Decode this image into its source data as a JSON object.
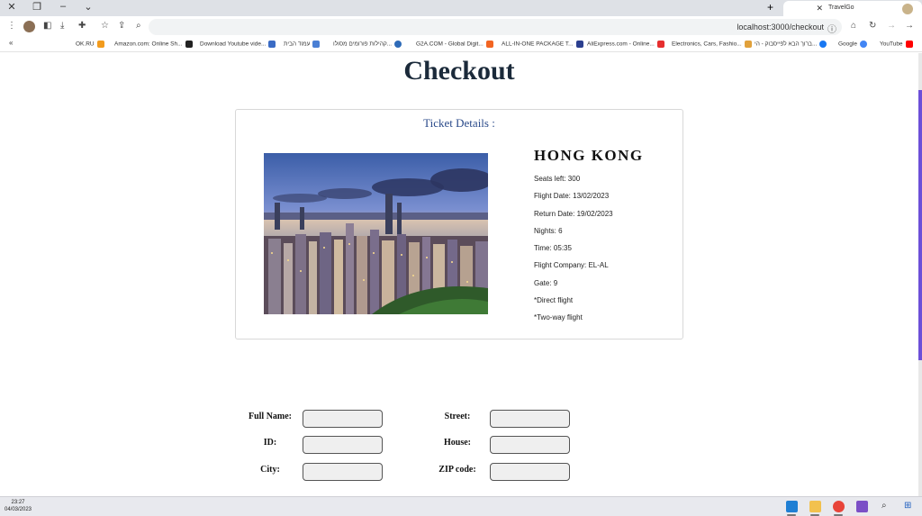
{
  "browser": {
    "tab_title": "TravelGo",
    "url": "localhost:3000/checkout",
    "bookmarks": [
      "OK.RU",
      "Amazon.com: Online Sh...",
      "Download Youtube vide...",
      "עמוד הבית",
      "קהילות פורומים מסולו...",
      "G2A.COM - Global Digit...",
      "ALL-IN-ONE PACKAGE T...",
      "AliExpress.com - Online...",
      "Electronics, Cars, Fashio...",
      "ברוך הבא לפייסבוק - הי...",
      "Google",
      "YouTube"
    ]
  },
  "page": {
    "heading": "Checkout",
    "ticket": {
      "title": "Ticket Details :",
      "destination": "HONG KONG",
      "details": [
        "Seats left: 300",
        "Flight Date: 13/02/2023",
        "Return Date: 19/02/2023",
        "Nights: 6",
        "Time: 05:35",
        "Flight Company: EL-AL",
        "Gate: 9",
        "*Direct flight",
        "*Two-way flight"
      ]
    },
    "form": {
      "full_name_label": "Full Name:",
      "id_label": "ID:",
      "city_label": "City:",
      "street_label": "Street:",
      "house_label": "House:",
      "zip_label": "ZIP code:",
      "full_name_value": "",
      "id_value": "",
      "city_value": "",
      "street_value": "",
      "house_value": "",
      "zip_value": ""
    }
  },
  "taskbar": {
    "time": "23:27",
    "date": "04/03/2023"
  },
  "colors": {
    "heading": "#1b2a3a",
    "card_title": "#2a4a8a",
    "scrollbar": "#6c4fd8"
  }
}
